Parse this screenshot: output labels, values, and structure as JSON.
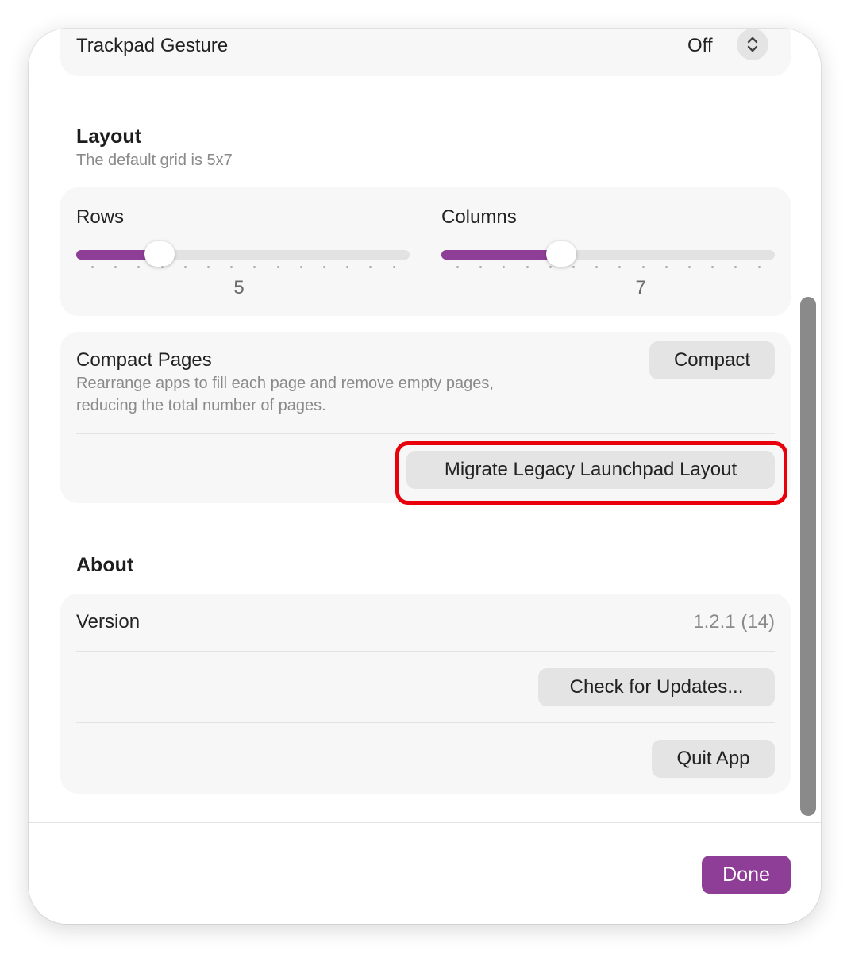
{
  "trackpad": {
    "label": "Trackpad Gesture",
    "value": "Off"
  },
  "layout": {
    "title": "Layout",
    "subtitle": "The default grid is 5x7",
    "rows": {
      "label": "Rows",
      "value": "5",
      "level": 0.25
    },
    "columns": {
      "label": "Columns",
      "value": "7",
      "level": 0.36
    }
  },
  "compact": {
    "title": "Compact Pages",
    "description_line1": "Rearrange apps to fill each page and remove empty pages,",
    "description_line2": "reducing the total number of pages.",
    "button": "Compact",
    "migrate_button": "Migrate Legacy Launchpad Layout"
  },
  "about": {
    "title": "About",
    "version_label": "Version",
    "version_value": "1.2.1 (14)",
    "check_updates": "Check for Updates...",
    "quit": "Quit App"
  },
  "footer": {
    "done": "Done"
  },
  "colors": {
    "accent": "#8e3e96",
    "highlight": "#e8000b"
  },
  "icons": {
    "stepper": "chevron-up-down-icon"
  }
}
